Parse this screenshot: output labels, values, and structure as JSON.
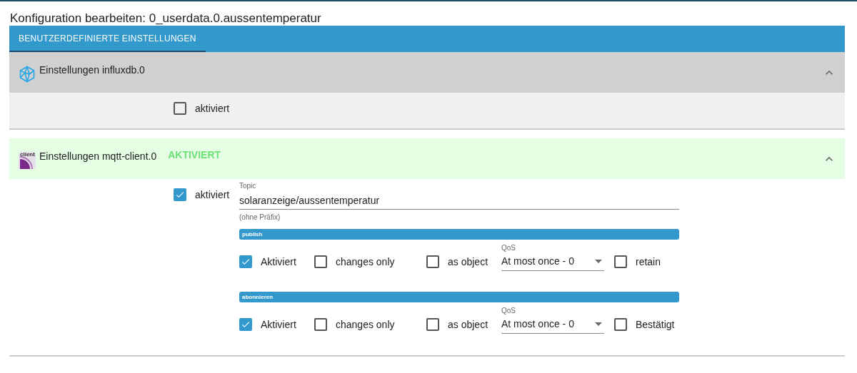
{
  "dialog_title": "Konfiguration bearbeiten: 0_userdata.0.aussentemperatur",
  "tabs": [
    {
      "label": "BENUTZERDEFINIERTE EINSTELLUNGEN",
      "selected": true
    }
  ],
  "panels": [
    {
      "title": "Einstellungen influxdb.0",
      "expanded": true,
      "enabled": false,
      "enabled_label": "aktiviert"
    },
    {
      "title": "Einstellungen mqtt-client.0",
      "icon_text": "client",
      "status": "AKTIVIERT",
      "expanded": true,
      "enabled": true,
      "enabled_label": "aktiviert",
      "topic": {
        "label": "Topic",
        "value": "solaranzeige/aussentemperatur",
        "helper": "(ohne Präfix)"
      },
      "sections": [
        {
          "header": "publish",
          "items": [
            {
              "kind": "checkbox",
              "label": "Aktiviert",
              "checked": true
            },
            {
              "kind": "checkbox",
              "label": "changes only",
              "checked": false
            },
            {
              "kind": "checkbox",
              "label": "as object",
              "checked": false
            },
            {
              "kind": "select",
              "label": "QoS",
              "value": "At most once - 0"
            },
            {
              "kind": "checkbox",
              "label": "retain",
              "checked": false
            }
          ]
        },
        {
          "header": "abonnieren",
          "items": [
            {
              "kind": "checkbox",
              "label": "Aktiviert",
              "checked": true
            },
            {
              "kind": "checkbox",
              "label": "changes only",
              "checked": false
            },
            {
              "kind": "checkbox",
              "label": "as object",
              "checked": false
            },
            {
              "kind": "select",
              "label": "QoS",
              "value": "At most once - 0"
            },
            {
              "kind": "checkbox",
              "label": "Bestätigt",
              "checked": false
            }
          ]
        }
      ]
    }
  ]
}
